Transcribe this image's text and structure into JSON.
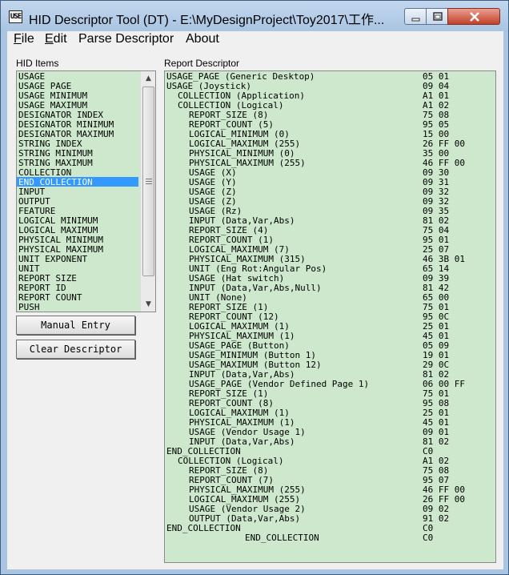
{
  "window": {
    "title": "HID Descriptor Tool (DT) - E:\\MyDesignProject\\Toy2017\\工作...",
    "app_icon_text": "USE"
  },
  "menu": [
    {
      "label": "File",
      "mnemonic": "F",
      "rest": "ile"
    },
    {
      "label": "Edit",
      "mnemonic": "E",
      "rest": "dit"
    },
    {
      "label": "Parse Descriptor",
      "mnemonic": "",
      "rest": "Parse Descriptor"
    },
    {
      "label": "About",
      "mnemonic": "",
      "rest": "About"
    }
  ],
  "hid_items_label": "HID Items",
  "report_label": "Report Descriptor",
  "hid_items": [
    "USAGE",
    "USAGE_PAGE",
    "USAGE_MINIMUM",
    "USAGE_MAXIMUM",
    "DESIGNATOR_INDEX",
    "DESIGNATOR_MINIMUM",
    "DESIGNATOR_MAXIMUM",
    "STRING_INDEX",
    "STRING_MINIMUM",
    "STRING_MAXIMUM",
    "COLLECTION",
    "END_COLLECTION",
    "INPUT",
    "OUTPUT",
    "FEATURE",
    "LOGICAL_MINIMUM",
    "LOGICAL_MAXIMUM",
    "PHYSICAL_MINIMUM",
    "PHYSICAL_MAXIMUM",
    "UNIT_EXPONENT",
    "UNIT",
    "REPORT_SIZE",
    "REPORT_ID",
    "REPORT_COUNT",
    "PUSH"
  ],
  "hid_items_selected": "END_COLLECTION",
  "buttons": {
    "manual_entry": "Manual Entry",
    "clear_descriptor": "Clear Descriptor"
  },
  "report_rows": [
    {
      "indent": 0,
      "text": "USAGE_PAGE (Generic Desktop)",
      "bytes": "05 01"
    },
    {
      "indent": 0,
      "text": "USAGE (Joystick)",
      "bytes": "09 04"
    },
    {
      "indent": 1,
      "text": "COLLECTION (Application)",
      "bytes": "A1 01"
    },
    {
      "indent": 1,
      "text": "COLLECTION (Logical)",
      "bytes": "A1 02"
    },
    {
      "indent": 2,
      "text": "REPORT_SIZE (8)",
      "bytes": "75 08"
    },
    {
      "indent": 2,
      "text": "REPORT_COUNT (5)",
      "bytes": "95 05"
    },
    {
      "indent": 2,
      "text": "LOGICAL_MINIMUM (0)",
      "bytes": "15 00"
    },
    {
      "indent": 2,
      "text": "LOGICAL_MAXIMUM (255)",
      "bytes": "26 FF 00"
    },
    {
      "indent": 2,
      "text": "PHYSICAL_MINIMUM (0)",
      "bytes": "35 00"
    },
    {
      "indent": 2,
      "text": "PHYSICAL_MAXIMUM (255)",
      "bytes": "46 FF 00"
    },
    {
      "indent": 2,
      "text": "USAGE (X)",
      "bytes": "09 30"
    },
    {
      "indent": 2,
      "text": "USAGE (Y)",
      "bytes": "09 31"
    },
    {
      "indent": 2,
      "text": "USAGE (Z)",
      "bytes": "09 32"
    },
    {
      "indent": 2,
      "text": "USAGE (Z)",
      "bytes": "09 32"
    },
    {
      "indent": 2,
      "text": "USAGE (Rz)",
      "bytes": "09 35"
    },
    {
      "indent": 2,
      "text": "INPUT (Data,Var,Abs)",
      "bytes": "81 02"
    },
    {
      "indent": 2,
      "text": "REPORT_SIZE (4)",
      "bytes": "75 04"
    },
    {
      "indent": 2,
      "text": "REPORT_COUNT (1)",
      "bytes": "95 01"
    },
    {
      "indent": 2,
      "text": "LOGICAL_MAXIMUM (7)",
      "bytes": "25 07"
    },
    {
      "indent": 2,
      "text": "PHYSICAL_MAXIMUM (315)",
      "bytes": "46 3B 01"
    },
    {
      "indent": 2,
      "text": "UNIT (Eng Rot:Angular Pos)",
      "bytes": "65 14"
    },
    {
      "indent": 2,
      "text": "USAGE (Hat switch)",
      "bytes": "09 39"
    },
    {
      "indent": 2,
      "text": "INPUT (Data,Var,Abs,Null)",
      "bytes": "81 42"
    },
    {
      "indent": 2,
      "text": "UNIT (None)",
      "bytes": "65 00"
    },
    {
      "indent": 2,
      "text": "REPORT_SIZE (1)",
      "bytes": "75 01"
    },
    {
      "indent": 2,
      "text": "REPORT_COUNT (12)",
      "bytes": "95 0C"
    },
    {
      "indent": 2,
      "text": "LOGICAL_MAXIMUM (1)",
      "bytes": "25 01"
    },
    {
      "indent": 2,
      "text": "PHYSICAL_MAXIMUM (1)",
      "bytes": "45 01"
    },
    {
      "indent": 2,
      "text": "USAGE_PAGE (Button)",
      "bytes": "05 09"
    },
    {
      "indent": 2,
      "text": "USAGE_MINIMUM (Button 1)",
      "bytes": "19 01"
    },
    {
      "indent": 2,
      "text": "USAGE_MAXIMUM (Button 12)",
      "bytes": "29 0C"
    },
    {
      "indent": 2,
      "text": "INPUT (Data,Var,Abs)",
      "bytes": "81 02"
    },
    {
      "indent": 2,
      "text": "USAGE_PAGE (Vendor Defined Page 1)",
      "bytes": "06 00 FF"
    },
    {
      "indent": 2,
      "text": "REPORT_SIZE (1)",
      "bytes": "75 01"
    },
    {
      "indent": 2,
      "text": "REPORT_COUNT (8)",
      "bytes": "95 08"
    },
    {
      "indent": 2,
      "text": "LOGICAL_MAXIMUM (1)",
      "bytes": "25 01"
    },
    {
      "indent": 2,
      "text": "PHYSICAL_MAXIMUM (1)",
      "bytes": "45 01"
    },
    {
      "indent": 2,
      "text": "USAGE (Vendor Usage 1)",
      "bytes": "09 01"
    },
    {
      "indent": 2,
      "text": "INPUT (Data,Var,Abs)",
      "bytes": "81 02"
    },
    {
      "indent": 0,
      "text": "END_COLLECTION",
      "bytes": "C0"
    },
    {
      "indent": 1,
      "text": "COLLECTION (Logical)",
      "bytes": "A1 02"
    },
    {
      "indent": 2,
      "text": "REPORT_SIZE (8)",
      "bytes": "75 08"
    },
    {
      "indent": 2,
      "text": "REPORT_COUNT (7)",
      "bytes": "95 07"
    },
    {
      "indent": 2,
      "text": "PHYSICAL_MAXIMUM (255)",
      "bytes": "46 FF 00"
    },
    {
      "indent": 2,
      "text": "LOGICAL_MAXIMUM (255)",
      "bytes": "26 FF 00"
    },
    {
      "indent": 2,
      "text": "USAGE (Vendor Usage 2)",
      "bytes": "09 02"
    },
    {
      "indent": 2,
      "text": "OUTPUT (Data,Var,Abs)",
      "bytes": "91 02"
    },
    {
      "indent": 0,
      "text": "END_COLLECTION",
      "bytes": "C0"
    },
    {
      "indent": 7,
      "text": "END_COLLECTION",
      "bytes": "C0"
    }
  ],
  "colors": {
    "list_background": "#cde8cd",
    "selection": "#3399ff",
    "titlebar": "#a9c5e2",
    "close_button": "#c2412a"
  }
}
